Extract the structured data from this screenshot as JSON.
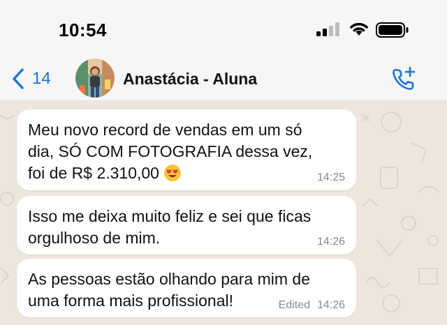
{
  "status_bar": {
    "time": "10:54"
  },
  "header": {
    "back_count": "14",
    "contact_name": "Anastácia - Aluna"
  },
  "messages": [
    {
      "text": "Meu novo record de vendas em um só\ndia,  SÓ COM FOTOGRAFIA dessa vez,\nfoi de R$ 2.310,00",
      "emoji": "heart-eyes-emoji",
      "time": "14:25"
    },
    {
      "text": "Isso me deixa muito feliz e sei que ficas\norgulhoso de mim.",
      "time": "14:26"
    },
    {
      "text": "As pessoas estão olhando para mim de\numa forma mais profissional!",
      "edited_label": "Edited",
      "time": "14:26"
    }
  ],
  "colors": {
    "accent": "#1a73d6",
    "bubble": "#ffffff",
    "wallpaper": "#ece6dd"
  }
}
